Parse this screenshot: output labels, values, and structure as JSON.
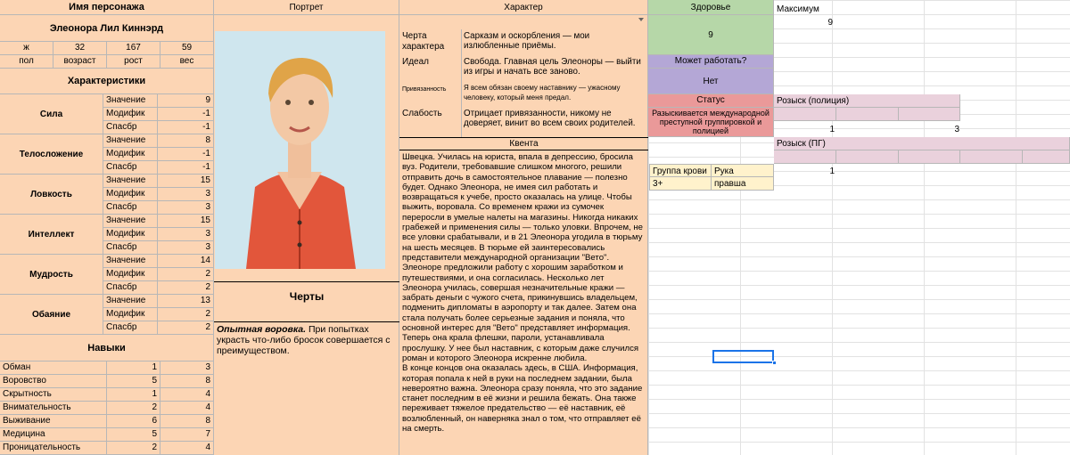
{
  "character": {
    "header": "Имя персонажа",
    "name": "Элеонора Лил Киннэрд",
    "sex": "ж",
    "age": "32",
    "height": "167",
    "weight": "59",
    "sex_label": "пол",
    "age_label": "возраст",
    "height_label": "рост",
    "weight_label": "вес",
    "stats_header": "Характеристики",
    "stats": [
      {
        "name": "Сила",
        "value": "9",
        "mod": "-1",
        "spasbr": "-1"
      },
      {
        "name": "Телосложение",
        "value": "8",
        "mod": "-1",
        "spasbr": "-1"
      },
      {
        "name": "Ловкость",
        "value": "15",
        "mod": "3",
        "spasbr": "3"
      },
      {
        "name": "Интеллект",
        "value": "15",
        "mod": "3",
        "spasbr": "3"
      },
      {
        "name": "Мудрость",
        "value": "14",
        "mod": "2",
        "spasbr": "2"
      },
      {
        "name": "Обаяние",
        "value": "13",
        "mod": "2",
        "spasbr": "2"
      }
    ],
    "sub_labels": {
      "value": "Значение",
      "mod": "Модифик",
      "spasbr": "Спасбр"
    },
    "skills_header": "Навыки",
    "skills": [
      {
        "name": "Обман",
        "a": "1",
        "b": "3"
      },
      {
        "name": "Воровство",
        "a": "5",
        "b": "8"
      },
      {
        "name": "Скрытность",
        "a": "1",
        "b": "4"
      },
      {
        "name": "Внимательность",
        "a": "2",
        "b": "4"
      },
      {
        "name": "Выживание",
        "a": "6",
        "b": "8"
      },
      {
        "name": "Медицина",
        "a": "5",
        "b": "7"
      },
      {
        "name": "Проницательность",
        "a": "2",
        "b": "4"
      }
    ]
  },
  "portrait": {
    "header": "Портрет",
    "traits_header": "Черты",
    "trait_name": "Опытная воровка.",
    "trait_text": " При попытках украсть что-либо бросок совершается с преимуществом."
  },
  "personality": {
    "header": "Характер",
    "rows": [
      {
        "label": "Черта характера",
        "text": "Сарказм и оскорбления — мои излюбленные приёмы."
      },
      {
        "label": "Идеал",
        "text": "Свобода. Главная цель Элеоноры — выйти из игры и начать все заново."
      },
      {
        "label": "Привязанность",
        "text": "Я всем обязан своему наставнику — ужасному человеку, который меня предал."
      },
      {
        "label": "Слабость",
        "text": "Отрицает привязанности, никому не доверяет, винит во всем своих родителей."
      }
    ],
    "quest_header": "Квента",
    "quest_text": "Швецка. Училась на юриста, впала в депрессию, бросила вуз. Родители, требовавшие слишком многого, решили отправить дочь в самостоятельное плавание — полезно будет. Однако Элеонора, не имея сил работать и возвращаться к учебе, просто оказалась на улице. Чтобы выжить, воровала. Со временем кражи из сумочек переросли в умелые налеты на магазины. Никогда никаких грабежей и применения силы — только уловки. Впрочем, не все уловки срабатывали, и в 21 Элеонора угодила в тюрьму на шесть месяцев. В тюрьме ей заинтересовались представители международной организации \"Вето\". Элеоноре предложили работу с хорошим заработком и путешествиями, и она согласилась. Несколько лет Элеонора училась, совершая незначительные кражи — забрать деньги с чужого счета, прикинувшись владельцем, подменить дипломаты в аэропорту и так далее. Затем она стала получать более серьезные задания и поняла, что основной интерес для \"Вето\" представляет информация. Теперь она крала флешки, пароли, устанавливала прослушку. У нее был наставник, с которым даже случился роман и которого Элеонора искренне любила.\nВ конце концов она оказалась здесь, в США. Информация, которая попала к ней в руки на последнем задании, была невероятно важна. Элеонора сразу поняла, что это задание станет последним в её жизни и решила бежать. Она также переживает тяжелое предательство — её наставник, её возлюбленный, он наверняка знал о том, что отправляет её на смерть."
  },
  "status_panel": {
    "health_header": "Здоровье",
    "health_value": "9",
    "max_label": "Максимум",
    "max_value": "9",
    "can_work_header": "Может работать?",
    "can_work_value": "Нет",
    "status_header": "Статус",
    "status_text": "Разыскивается международной преступной группировкой и полицией",
    "wanted_police": "Розыск (полиция)",
    "wanted_police_vals": [
      "1",
      "3"
    ],
    "wanted_pg": "Розыск (ПГ)",
    "wanted_pg_val": "1",
    "blood_label": "Группа крови",
    "blood_value": "3+",
    "hand_label": "Рука",
    "hand_value": "правша"
  },
  "colors": {
    "peach": "#fcd5b4",
    "green": "#b6d7a8",
    "purple": "#b4a7d6",
    "pink": "#ea9999",
    "light_pink": "#ead1dc",
    "light_yellow": "#fff2cc",
    "selection": "#1a73e8"
  }
}
